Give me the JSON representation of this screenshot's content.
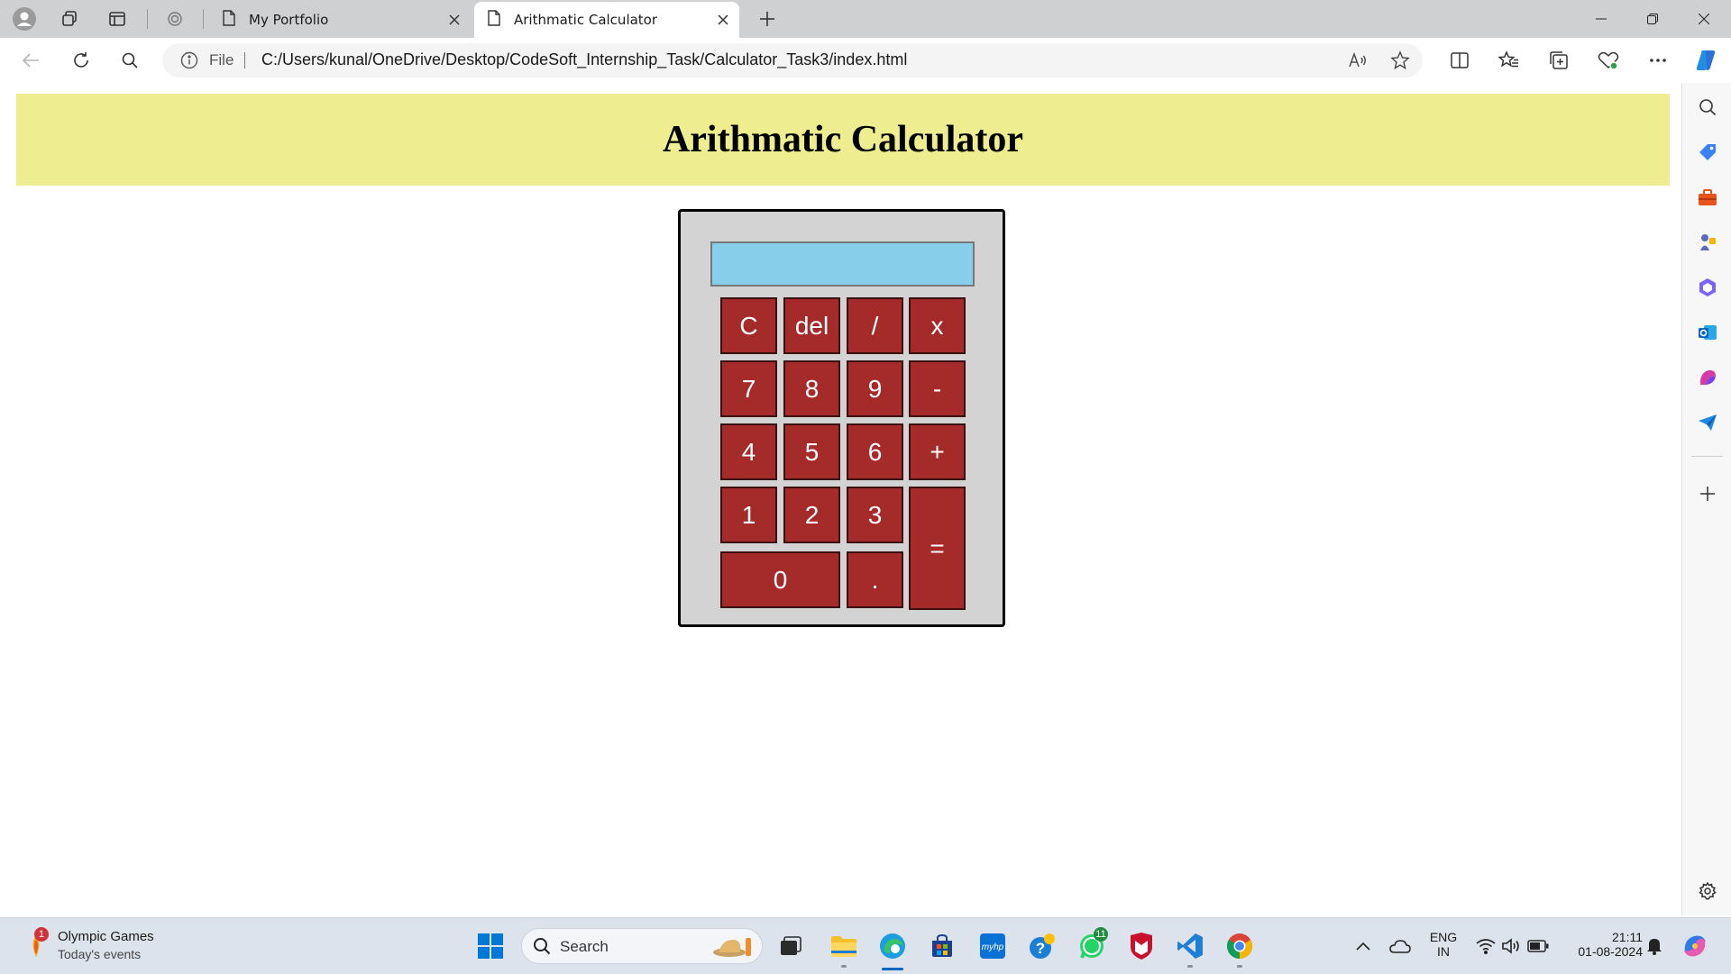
{
  "browser": {
    "tabs": [
      {
        "title": "My Portfolio",
        "active": false
      },
      {
        "title": "Arithmatic Calculator",
        "active": true
      }
    ],
    "address": {
      "scheme_label": "File",
      "url": "C:/Users/kunal/OneDrive/Desktop/CodeSoft_Internship_Task/Calculator_Task3/index.html"
    }
  },
  "page": {
    "title": "Arithmatic Calculator",
    "colors": {
      "header_bg": "#eeee90",
      "display_bg": "#87ceeb",
      "key_bg": "#a52a2a",
      "calc_bg": "#d3d3d3"
    },
    "display_value": "",
    "keys": {
      "clear": "C",
      "del": "del",
      "divide": "/",
      "multiply": "x",
      "seven": "7",
      "eight": "8",
      "nine": "9",
      "minus": "-",
      "four": "4",
      "five": "5",
      "six": "6",
      "plus": "+",
      "one": "1",
      "two": "2",
      "three": "3",
      "equals": "=",
      "zero": "0",
      "dot": "."
    }
  },
  "taskbar": {
    "widget": {
      "title": "Olympic Games",
      "subtitle": "Today's events",
      "badge": "1"
    },
    "search_label": "Search",
    "whatsapp_badge": "11",
    "language": {
      "line1": "ENG",
      "line2": "IN"
    },
    "clock": {
      "time": "21:11",
      "date": "01-08-2024"
    }
  }
}
